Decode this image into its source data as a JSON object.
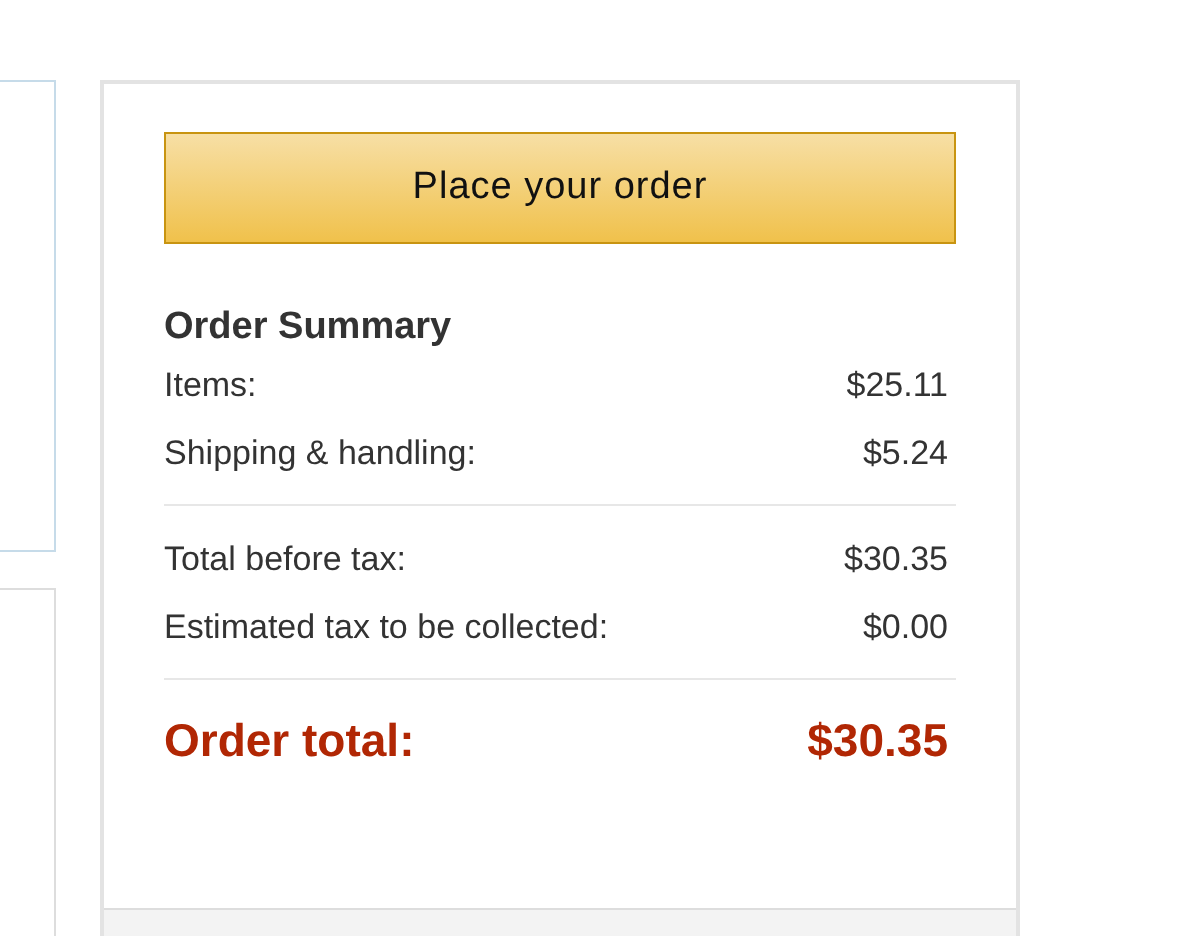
{
  "button": {
    "label": "Place your order"
  },
  "summary": {
    "title": "Order Summary",
    "sections": [
      {
        "rows": [
          {
            "kind": "line",
            "label": "Items:",
            "value": "$25.11"
          },
          {
            "kind": "line",
            "label": "Shipping & handling:",
            "value": "$5.24"
          }
        ]
      },
      {
        "rows": [
          {
            "kind": "line",
            "label": "Total before tax:",
            "value": "$30.35"
          },
          {
            "kind": "line",
            "label": "Estimated tax to be collected:",
            "value": "$0.00"
          }
        ]
      },
      {
        "rows": [
          {
            "kind": "total",
            "label": "Order total:",
            "value": "$30.35"
          }
        ]
      }
    ]
  }
}
